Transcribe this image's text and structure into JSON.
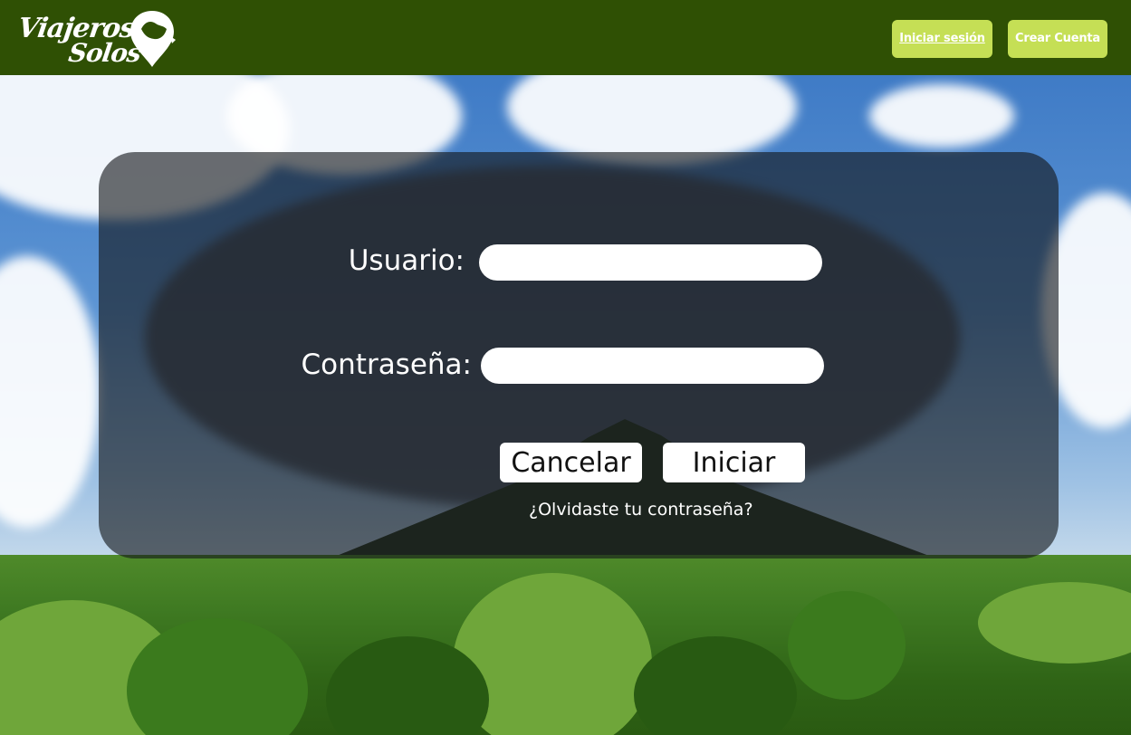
{
  "brand": {
    "name_line1": "Viajeros",
    "name_line2": "Solos",
    "logo_icon": "map-pin-icon"
  },
  "header": {
    "login_label": "Iniciar sesión",
    "create_account_label": "Crear Cuenta"
  },
  "login_form": {
    "username_label": "Usuario:",
    "username_value": "",
    "password_label": "Contraseña:",
    "password_value": "",
    "cancel_label": "Cancelar",
    "submit_label": "Iniciar",
    "forgot_password_label": "¿Olvidaste tu contraseña?"
  },
  "colors": {
    "header_bg": "#2f5004",
    "accent": "#c5df55",
    "panel_overlay": "rgba(20,22,26,0.62)"
  }
}
